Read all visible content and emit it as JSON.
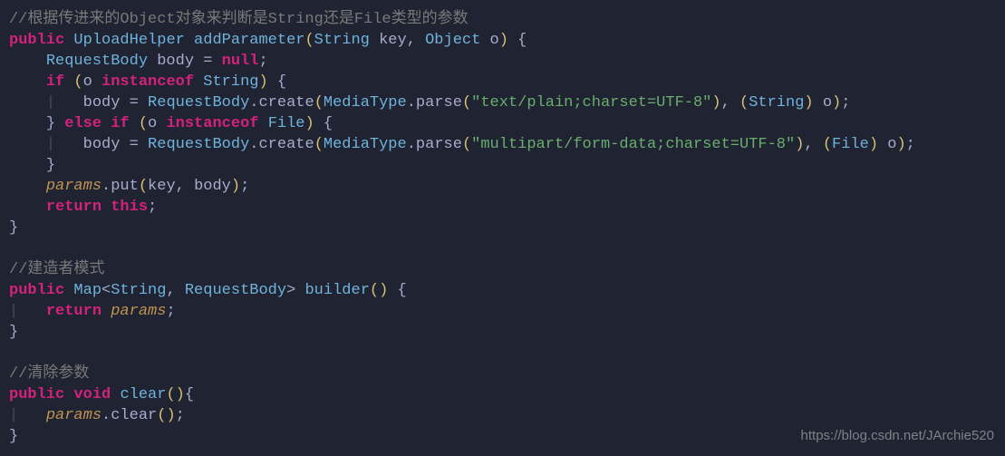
{
  "comments": {
    "c1": "//根据传进来的Object对象来判断是String还是File类型的参数",
    "c2": "//建造者模式",
    "c3": "//清除参数"
  },
  "keywords": {
    "public": "public",
    "null": "null",
    "if": "if",
    "instanceof": "instanceof",
    "else": "else",
    "return": "return",
    "this": "this",
    "void": "void"
  },
  "types": {
    "UploadHelper": "UploadHelper",
    "String": "String",
    "Object": "Object",
    "RequestBody": "RequestBody",
    "MediaType": "MediaType",
    "File": "File",
    "Map": "Map"
  },
  "methods": {
    "addParameter": "addParameter",
    "create": "create",
    "parse": "parse",
    "put": "put",
    "builder": "builder",
    "clear": "clear"
  },
  "vars": {
    "key": "key",
    "o": "o",
    "body": "body"
  },
  "fields": {
    "params": "params"
  },
  "strings": {
    "textPlain": "\"text/plain;charset=UTF-8\"",
    "multipart": "\"multipart/form-data;charset=UTF-8\""
  },
  "watermark": "https://blog.csdn.net/JArchie520"
}
